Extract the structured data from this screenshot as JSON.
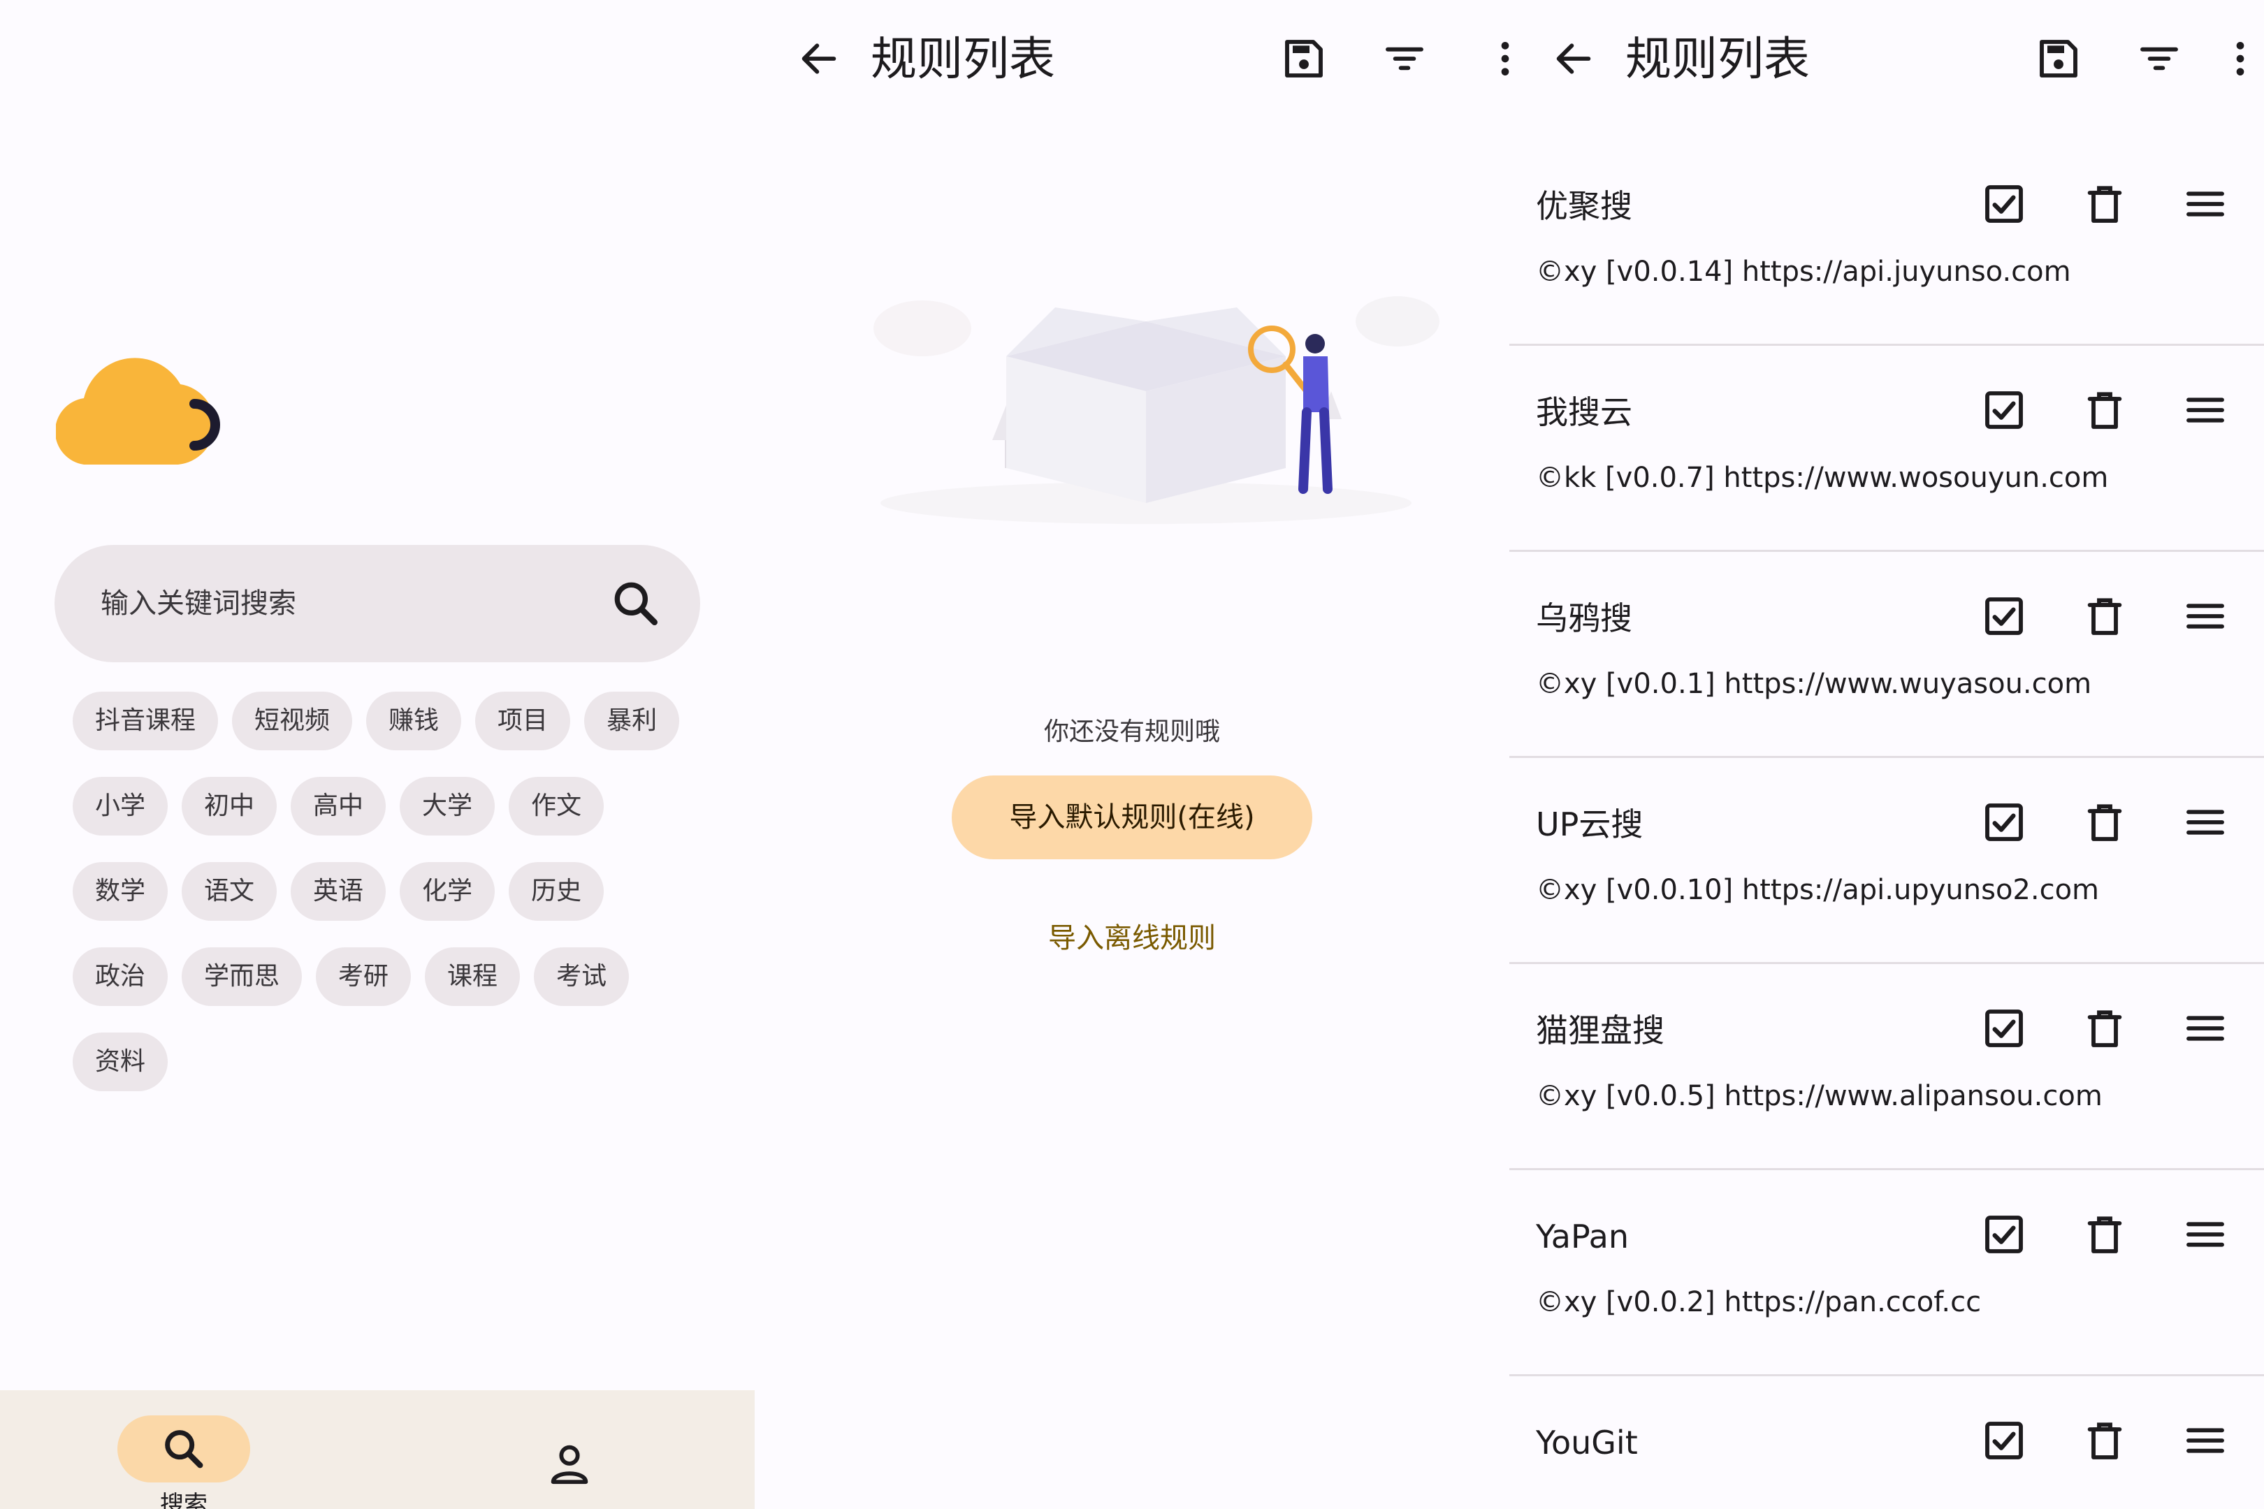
{
  "home": {
    "search_placeholder": "输入关键词搜索",
    "chip_rows": [
      [
        "抖音课程",
        "短视频",
        "赚钱",
        "项目",
        "暴利"
      ],
      [
        "小学",
        "初中",
        "高中",
        "大学",
        "作文"
      ],
      [
        "数学",
        "语文",
        "英语",
        "化学",
        "历史"
      ],
      [
        "政治",
        "学而思",
        "考研",
        "课程",
        "考试"
      ],
      [
        "资料"
      ]
    ],
    "nav": {
      "search_label": "搜索"
    }
  },
  "rules_empty": {
    "title": "规则列表",
    "empty_text": "你还没有规则哦",
    "import_default": "导入默认规则(在线)",
    "import_offline": "导入离线规则"
  },
  "rules_list": {
    "title": "规则列表",
    "items": [
      {
        "name": "优聚搜",
        "meta": "©xy [v0.0.14] https://api.juyunso.com"
      },
      {
        "name": "我搜云",
        "meta": "©kk [v0.0.7] https://www.wosouyun.com"
      },
      {
        "name": "乌鸦搜",
        "meta": "©xy [v0.0.1] https://www.wuyasou.com"
      },
      {
        "name": "UP云搜",
        "meta": "©xy [v0.0.10] https://api.upyunso2.com"
      },
      {
        "name": "猫狸盘搜",
        "meta": "©xy [v0.0.5] https://www.alipansou.com"
      },
      {
        "name": "YaPan",
        "meta": "©xy [v0.0.2] https://pan.ccof.cc"
      },
      {
        "name": "YouGit",
        "meta": ""
      }
    ]
  },
  "icons": {
    "back": "arrow-back-icon",
    "save": "save-icon",
    "filter": "filter-icon",
    "more": "more-vert-icon",
    "check": "checkbox-checked-icon",
    "delete": "delete-icon",
    "drag": "drag-handle-icon",
    "search": "search-icon",
    "person": "person-icon"
  },
  "colors": {
    "accent_light": "#fdd8a8",
    "logo_orange": "#f9b53a",
    "offline_link": "#7a5a00",
    "nav_bg": "#f3ede6",
    "chip_bg": "#ece6ea"
  }
}
